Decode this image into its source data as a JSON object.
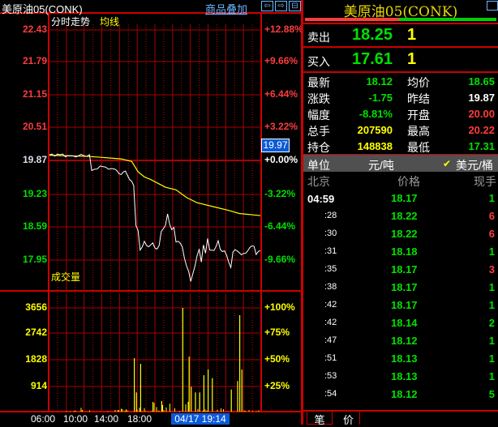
{
  "header": {
    "symbol": "美原油05(CONK)",
    "overlay_link": "商品叠加",
    "nav_icons": [
      "arrow-left-icon",
      "arrow-right-icon",
      "split-icon"
    ]
  },
  "chart": {
    "title": "分时走势",
    "avg_label": "均线",
    "volume_title": "成交量",
    "current_price_tag": "19.97",
    "price_ticks": [
      "22.43",
      "21.79",
      "21.15",
      "20.51",
      "19.87",
      "19.23",
      "18.59",
      "17.95"
    ],
    "pct_ticks": [
      "+12.88%",
      "+9.66%",
      "+6.44%",
      "+3.22%",
      "+0.00%",
      "-3.22%",
      "-6.44%",
      "-9.66%"
    ],
    "vol_ticks": [
      "3656",
      "2742",
      "1828",
      "914"
    ],
    "vol_pct_ticks": [
      "+100%",
      "+75%",
      "+50%",
      "+25%"
    ],
    "time_ticks": [
      "06:00",
      "10:00",
      "14:00",
      "18:00",
      ":00"
    ],
    "cursor_time": "04/17 19:14"
  },
  "chart_data": {
    "type": "line",
    "prev_settle": 19.87,
    "ylim": [
      17.31,
      22.43
    ],
    "price": [
      [
        0,
        19.97
      ],
      [
        0.05,
        19.99
      ],
      [
        0.1,
        19.95
      ],
      [
        0.15,
        19.98
      ],
      [
        0.19,
        19.95
      ],
      [
        0.2,
        19.7
      ],
      [
        0.24,
        19.74
      ],
      [
        0.28,
        19.72
      ],
      [
        0.31,
        19.72
      ],
      [
        0.33,
        19.6
      ],
      [
        0.35,
        19.62
      ],
      [
        0.36,
        19.68
      ],
      [
        0.37,
        19.58
      ],
      [
        0.38,
        19.5
      ],
      [
        0.39,
        19.45
      ],
      [
        0.4,
        19.38
      ],
      [
        0.4,
        19.3
      ],
      [
        0.41,
        18.6
      ],
      [
        0.42,
        18.5
      ],
      [
        0.43,
        18.1
      ],
      [
        0.45,
        18.28
      ],
      [
        0.47,
        18.22
      ],
      [
        0.49,
        18.25
      ],
      [
        0.5,
        18.15
      ],
      [
        0.52,
        18.2
      ],
      [
        0.53,
        18.5
      ],
      [
        0.55,
        18.6
      ],
      [
        0.56,
        18.85
      ],
      [
        0.57,
        18.6
      ],
      [
        0.58,
        18.5
      ],
      [
        0.59,
        18.6
      ],
      [
        0.6,
        18.3
      ],
      [
        0.61,
        18.32
      ],
      [
        0.63,
        18.22
      ],
      [
        0.64,
        18.0
      ],
      [
        0.65,
        17.8
      ],
      [
        0.66,
        17.7
      ],
      [
        0.67,
        17.55
      ],
      [
        0.68,
        17.7
      ],
      [
        0.69,
        17.85
      ],
      [
        0.7,
        18.0
      ],
      [
        0.71,
        18.15
      ],
      [
        0.72,
        17.9
      ],
      [
        0.73,
        18.2
      ],
      [
        0.74,
        18.05
      ],
      [
        0.75,
        18.35
      ],
      [
        0.76,
        18.1
      ],
      [
        0.78,
        18.15
      ],
      [
        0.79,
        18.2
      ],
      [
        0.8,
        18.32
      ],
      [
        0.81,
        18.15
      ],
      [
        0.83,
        18.1
      ],
      [
        0.84,
        18.05
      ],
      [
        0.85,
        17.9
      ],
      [
        0.86,
        17.8
      ],
      [
        0.87,
        18.12
      ],
      [
        0.89,
        18.1
      ],
      [
        0.91,
        18.05
      ],
      [
        0.93,
        18.08
      ],
      [
        0.95,
        18.2
      ],
      [
        0.97,
        18.18
      ],
      [
        0.98,
        18.05
      ],
      [
        1.0,
        18.12
      ]
    ],
    "avg": [
      [
        0,
        19.97
      ],
      [
        0.18,
        19.95
      ],
      [
        0.34,
        19.9
      ],
      [
        0.39,
        19.85
      ],
      [
        0.42,
        19.65
      ],
      [
        0.45,
        19.55
      ],
      [
        0.48,
        19.5
      ],
      [
        0.55,
        19.35
      ],
      [
        0.6,
        19.3
      ],
      [
        0.65,
        19.15
      ],
      [
        0.7,
        19.05
      ],
      [
        0.78,
        18.97
      ],
      [
        0.85,
        18.9
      ],
      [
        0.9,
        18.84
      ],
      [
        1.0,
        18.8
      ]
    ],
    "volume_spikes": [
      [
        0.4,
        1900
      ],
      [
        0.41,
        700
      ],
      [
        0.43,
        1700
      ],
      [
        0.53,
        400
      ],
      [
        0.63,
        3656
      ],
      [
        0.66,
        1950
      ],
      [
        0.67,
        900
      ],
      [
        0.69,
        700
      ],
      [
        0.71,
        700
      ],
      [
        0.73,
        1300
      ],
      [
        0.75,
        1500
      ],
      [
        0.77,
        1200
      ],
      [
        0.86,
        800
      ],
      [
        0.89,
        1100
      ],
      [
        0.9,
        3400
      ],
      [
        0.91,
        1500
      ]
    ],
    "volume_max": 3656
  },
  "quote": {
    "title": "美原油05(CONK)",
    "sell_label": "卖出",
    "sell_price": "18.25",
    "sell_qty": "1",
    "buy_label": "买入",
    "buy_price": "17.61",
    "buy_qty": "1",
    "buy_sell_ratio": 0.49,
    "stats": [
      {
        "l1": "最新",
        "v1": "18.12",
        "c1": "green",
        "l2": "均价",
        "v2": "18.65",
        "c2": "green"
      },
      {
        "l1": "涨跌",
        "v1": "-1.75",
        "c1": "green",
        "l2": "昨结",
        "v2": "19.87",
        "c2": "white"
      },
      {
        "l1": "幅度",
        "v1": "-8.81%",
        "c1": "green",
        "l2": "开盘",
        "v2": "20.00",
        "c2": "red"
      },
      {
        "l1": "总手",
        "v1": "207590",
        "c1": "yellow",
        "l2": "最高",
        "v2": "20.22",
        "c2": "red"
      },
      {
        "l1": "持仓",
        "v1": "148838",
        "c1": "yellow",
        "l2": "最低",
        "v2": "17.31",
        "c2": "green"
      }
    ],
    "unit_label": "单位",
    "unit_option1": "元/吨",
    "unit_option2": "美元/桶",
    "col_time": "北京",
    "col_price": "价格",
    "col_qty": "现手"
  },
  "trades": [
    {
      "t": "04:59",
      "p": "18.17",
      "q": "1",
      "qc": "green"
    },
    {
      "t": ":28",
      "p": "18.22",
      "q": "6",
      "qc": "red"
    },
    {
      "t": ":30",
      "p": "18.22",
      "q": "6",
      "qc": "red"
    },
    {
      "t": ":31",
      "p": "18.18",
      "q": "1",
      "qc": "green"
    },
    {
      "t": ":35",
      "p": "18.17",
      "q": "3",
      "qc": "red"
    },
    {
      "t": ":38",
      "p": "18.17",
      "q": "1",
      "qc": "green"
    },
    {
      "t": ":42",
      "p": "18.17",
      "q": "1",
      "qc": "green"
    },
    {
      "t": ":42",
      "p": "18.14",
      "q": "2",
      "qc": "green"
    },
    {
      "t": ":47",
      "p": "18.12",
      "q": "1",
      "qc": "green"
    },
    {
      "t": ":51",
      "p": "18.13",
      "q": "1",
      "qc": "green"
    },
    {
      "t": ":53",
      "p": "18.13",
      "q": "1",
      "qc": "green"
    },
    {
      "t": ":54",
      "p": "18.12",
      "q": "5",
      "qc": "green"
    }
  ],
  "tabs": [
    "笔",
    "价"
  ]
}
